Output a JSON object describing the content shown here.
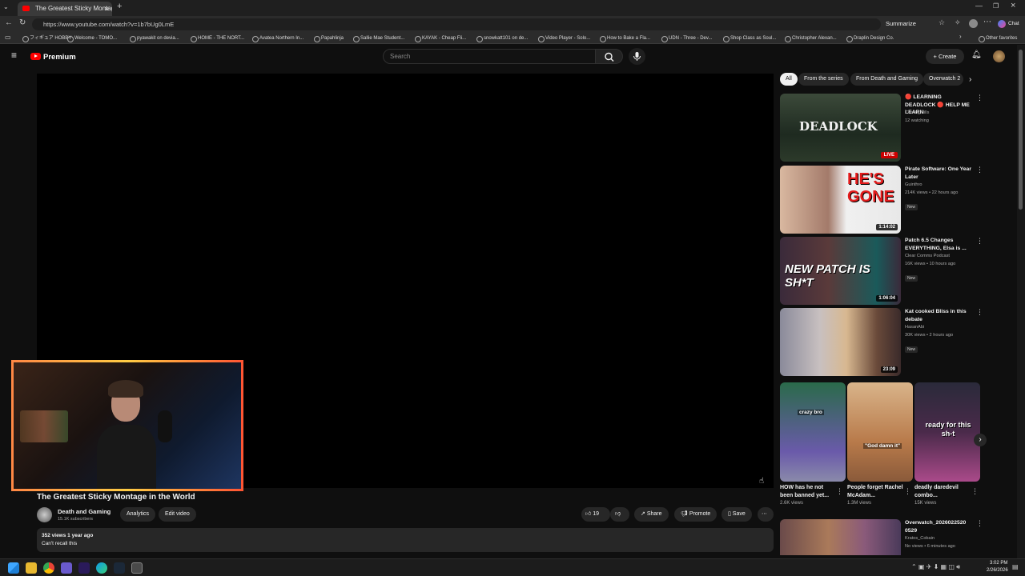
{
  "browser": {
    "tab_title": "The Greatest Sticky Montage in th",
    "url": "https://www.youtube.com/watch?v=1b7bUg0LmE",
    "summarize_label": "Summarize",
    "other_favorites": "Other favorites",
    "chat_label": "Chat",
    "bookmarks": [
      "フィギュア HOBBY",
      "Welcome - TOMO...",
      "pyawakit on devia...",
      "HOME - THE NORT...",
      "Avatea Northern In...",
      "Papahlinja",
      "Sallie Mae Student...",
      "KAYAK - Cheap Fli...",
      "snowkatt101 on de...",
      "Video Player - Solo...",
      "How to Bake a Fla...",
      "UDN - Three - Dev...",
      "Shop Class as Soul...",
      "Christopher Alexan...",
      "Draplin Design Co."
    ]
  },
  "youtube": {
    "logo_text": "Premium",
    "search_placeholder": "Search",
    "create_label": "Create",
    "video": {
      "title": "The Greatest Sticky Montage in the World",
      "channel": "Death and Gaming",
      "subscribers": "15.1K subscribers",
      "analytics_label": "Analytics",
      "edit_label": "Edit video",
      "likes": "19",
      "share_label": "Share",
      "promote_label": "Promote",
      "save_label": "Save",
      "views_age": "352 views  1 year ago",
      "description": "Can't recall this"
    },
    "chips": [
      "All",
      "From the series",
      "From Death and Gaming",
      "Overwatch 2"
    ],
    "recs": [
      {
        "title": "🔴 LEARNING DEADLOCK 🔴 HELP ME LEARN",
        "channel": "Coach_Mills",
        "meta": "12 watching",
        "badge": "",
        "live": "LIVE",
        "dur": "",
        "thumb_text": "DEADLOCK"
      },
      {
        "title": "Pirate Software: One Year Later",
        "channel": "Guinthro",
        "meta": "214K views • 22 hours ago",
        "badge": "New",
        "live": "",
        "dur": "1:14:02",
        "thumb_text": "HE'S GONE"
      },
      {
        "title": "Patch 6.5 Changes EVERYTHING, Elsa is ...",
        "channel": "Clear Comms Podcast",
        "meta": "16K views • 10 hours ago",
        "badge": "New",
        "live": "",
        "dur": "1:06:04",
        "thumb_text": "NEW PATCH IS SH*T"
      },
      {
        "title": "Kat cooked Bliss in this debate",
        "channel": "HasanAbi",
        "meta": "30K views • 2 hours ago",
        "badge": "New",
        "live": "",
        "dur": "23:09",
        "thumb_text": ""
      }
    ],
    "shorts": [
      {
        "title": "HOW has he not been banned yet...",
        "views": "2.6K views",
        "overlay": "crazy bro"
      },
      {
        "title": "People forget Rachel McAdam...",
        "views": "1.3M views",
        "overlay": "\"God damn it\""
      },
      {
        "title": "deadly daredevil combo...",
        "views": "15K views",
        "overlay": "ready for this sh-t"
      }
    ],
    "last_rec": {
      "title": "Overwatch_2026022520 0529",
      "channel": "Kratos_Cobain",
      "meta": "No views • 6 minutes ago"
    }
  },
  "taskbar": {
    "time": "3:02 PM",
    "date": "2/26/2026"
  },
  "colors": {
    "yt_red": "#ff0000",
    "bg": "#0f0f0f",
    "chip": "#272727"
  }
}
